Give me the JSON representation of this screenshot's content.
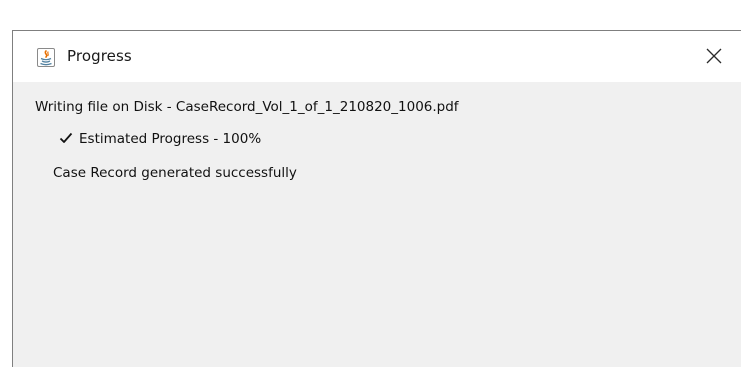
{
  "dialog": {
    "title": "Progress",
    "icons": {
      "title": "java-app-icon",
      "close": "close-icon",
      "check": "checkmark-icon"
    },
    "message": "Writing file on Disk - CaseRecord_Vol_1_of_1_210820_1006.pdf",
    "progress_label": "Estimated Progress - 100%",
    "progress_value": 100,
    "status": "Case Record generated successfully"
  },
  "colors": {
    "titlebar_bg": "#ffffff",
    "body_bg": "#f0f0f0",
    "border": "#7f7f7f",
    "text": "#111111",
    "icon_orange": "#e76f00",
    "icon_blue": "#5382a1"
  }
}
